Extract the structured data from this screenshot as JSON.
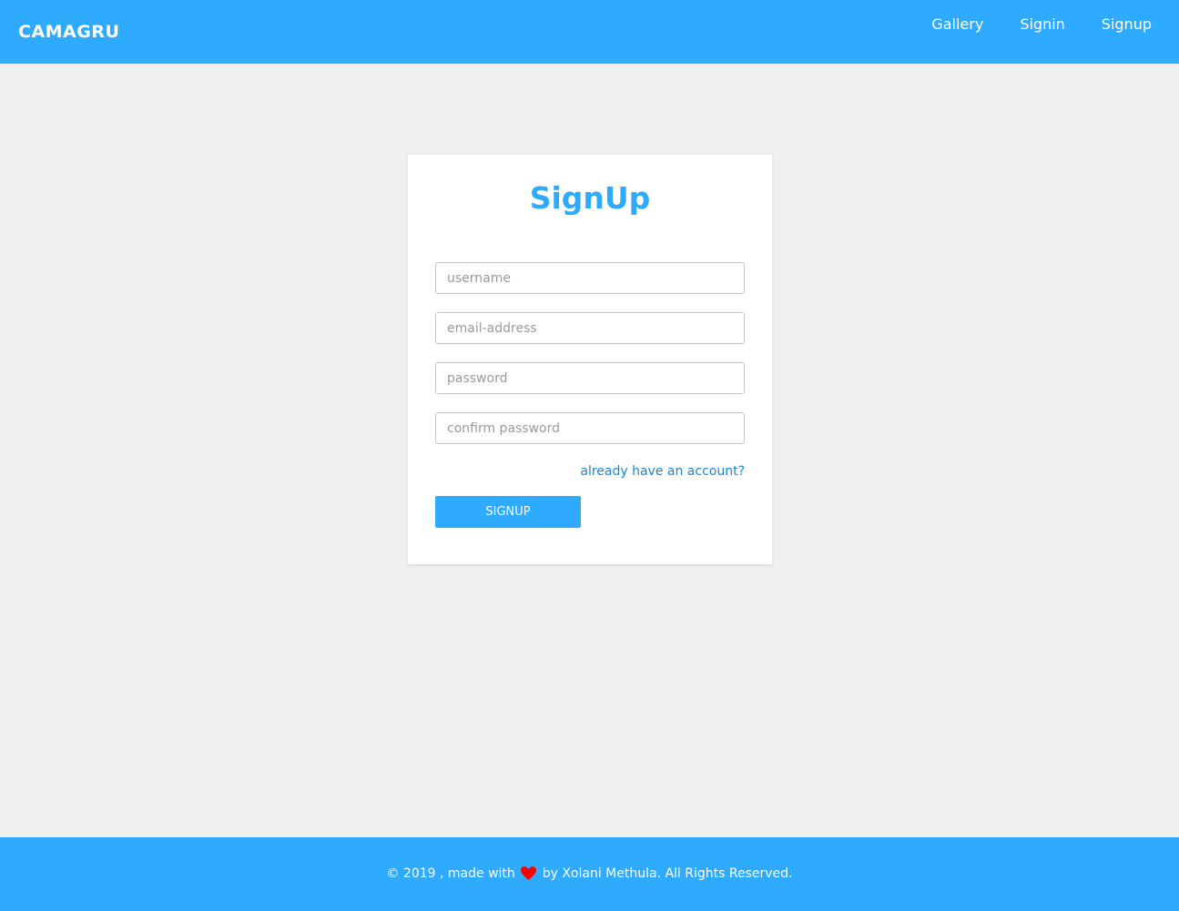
{
  "header": {
    "brand": "CAMAGRU",
    "nav": [
      {
        "label": "Gallery"
      },
      {
        "label": "Signin"
      },
      {
        "label": "Signup"
      }
    ]
  },
  "form": {
    "title": "SignUp",
    "fields": [
      {
        "placeholder": "username",
        "value": ""
      },
      {
        "placeholder": "email-address",
        "value": ""
      },
      {
        "placeholder": "password",
        "value": ""
      },
      {
        "placeholder": "confirm password",
        "value": ""
      }
    ],
    "account_link": "already have an account?",
    "submit_label": "SIGNUP"
  },
  "footer": {
    "prefix": "© 2019 , made with",
    "icon": "heart-icon",
    "suffix": "by Xolani Methula. All Rights Reserved."
  },
  "colors": {
    "brand_blue": "#2eaaff",
    "link_blue": "#1a86d6",
    "heart_red": "#ff0000",
    "page_background": "#efefef"
  }
}
